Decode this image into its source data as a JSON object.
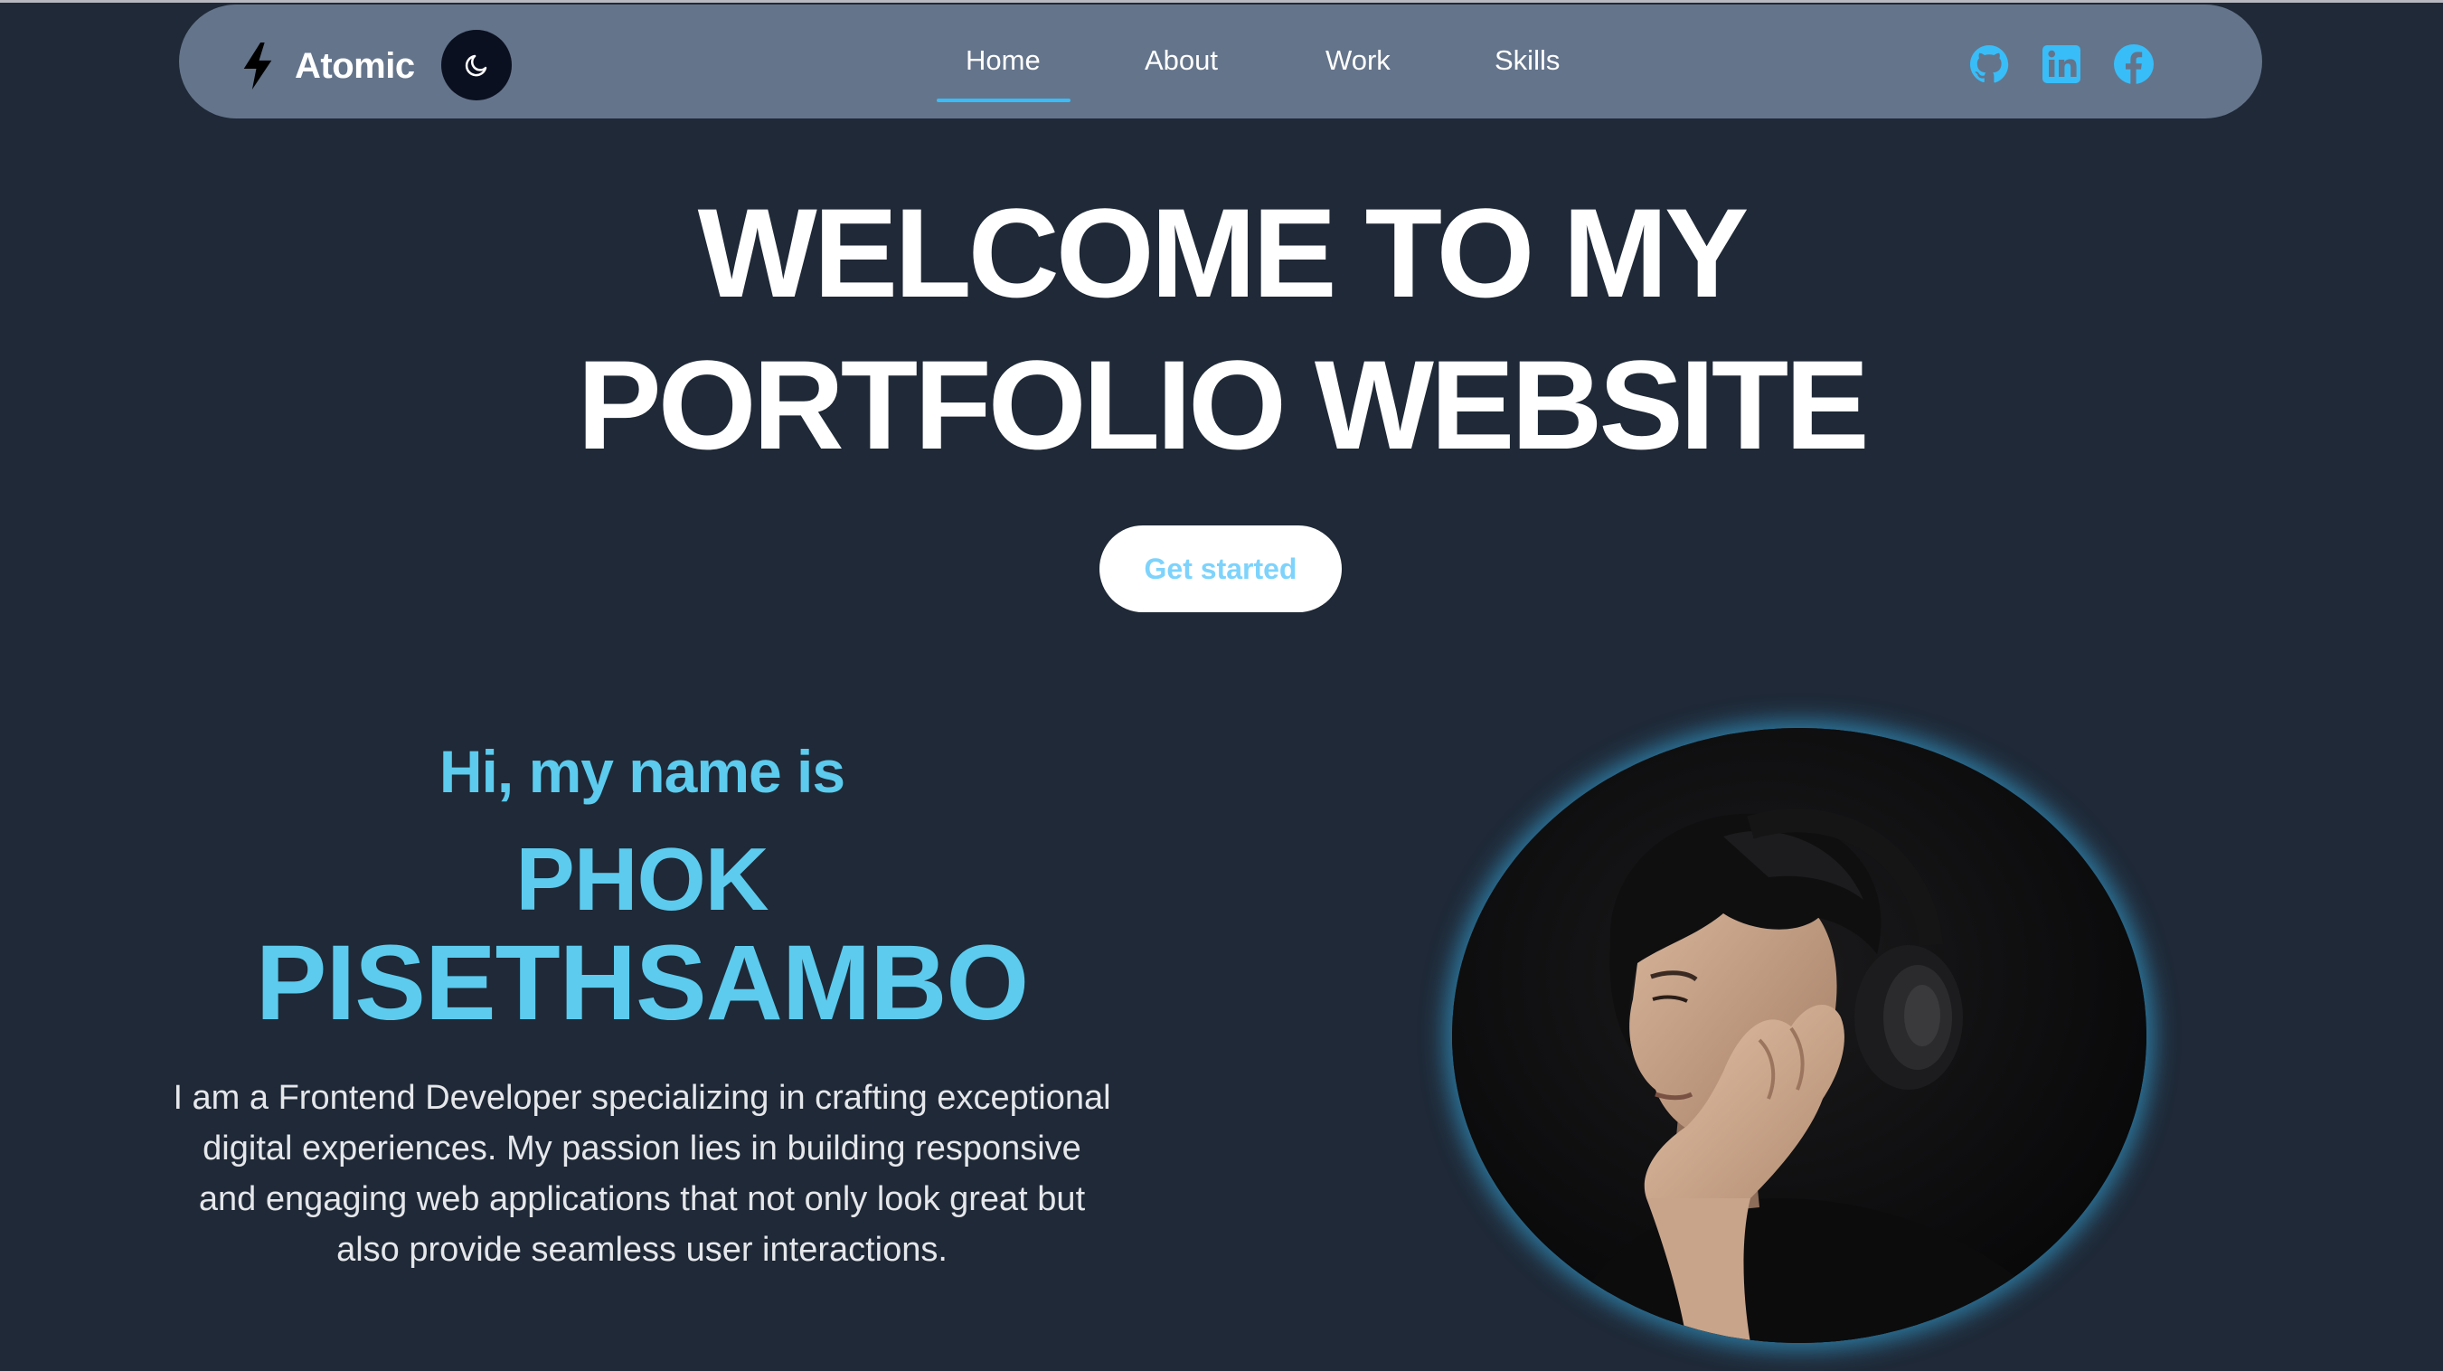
{
  "nav": {
    "brand": "Atomic",
    "brand_icon": "bolt-icon",
    "theme_toggle_icon": "moon-icon",
    "links": [
      {
        "label": "Home",
        "active": true
      },
      {
        "label": "About"
      },
      {
        "label": "Work"
      },
      {
        "label": "Skills"
      }
    ],
    "social": [
      "github-icon",
      "linkedin-icon",
      "facebook-icon"
    ]
  },
  "hero": {
    "title_line1": "WELCOME TO MY",
    "title_line2": "PORTFOLIO WEBSITE",
    "cta": "Get started"
  },
  "intro": {
    "greeting": "Hi, my name is",
    "name_first": "PHOK",
    "name_last": "PISETHSAMBO",
    "bio": "I am a Frontend Developer specializing in crafting exceptional digital experiences. My passion lies in building responsive and engaging web applications that not only look great but also provide seamless user interactions."
  },
  "colors": {
    "background": "#1f2937",
    "navbar": "#64748b",
    "accent": "#5ccbee",
    "active_underline": "#38bdf8",
    "toggle_bg": "#0b1020"
  }
}
